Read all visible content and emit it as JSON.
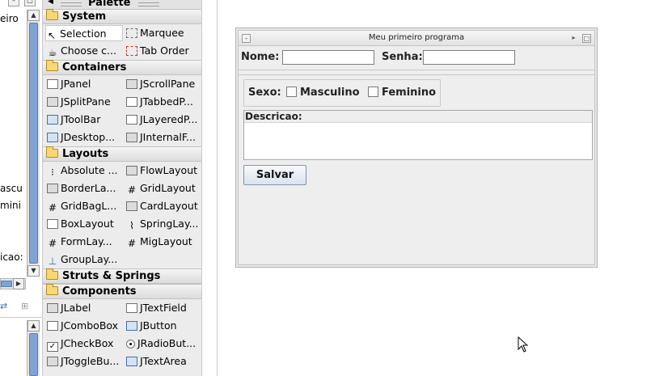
{
  "left_panel": {
    "texts": [
      "eiro",
      "ascu",
      "mini",
      "icao:"
    ]
  },
  "palette": {
    "title": "Palette",
    "categories": {
      "system": {
        "label": "System",
        "items": [
          "Selection",
          "Marquee",
          "Choose c...",
          "Tab Order"
        ]
      },
      "containers": {
        "label": "Containers",
        "items": [
          "JPanel",
          "JScrollPane",
          "JSplitPane",
          "JTabbedP...",
          "JToolBar",
          "JLayeredP...",
          "JDesktop...",
          "JInternalF..."
        ]
      },
      "layouts": {
        "label": "Layouts",
        "items": [
          "Absolute ...",
          "FlowLayout",
          "BorderLa...",
          "GridLayout",
          "GridBagL...",
          "CardLayout",
          "BoxLayout",
          "SpringLay...",
          "FormLay...",
          "MigLayout",
          "GroupLay..."
        ]
      },
      "struts": {
        "label": "Struts & Springs"
      },
      "components": {
        "label": "Components",
        "items": [
          "JLabel",
          "JTextField",
          "JComboBox",
          "JButton",
          "JCheckBox",
          "JRadioBut...",
          "JToggleBu...",
          "JTextArea"
        ]
      }
    }
  },
  "form": {
    "title": "Meu primeiro programa",
    "nome_label": "Nome:",
    "nome_value": "",
    "senha_label": "Senha:",
    "senha_value": "",
    "sexo_label": "Sexo:",
    "masculino_label": "Masculino",
    "feminino_label": "Feminino",
    "descricao_label": "Descricao:",
    "descricao_value": "",
    "salvar_label": "Salvar"
  }
}
